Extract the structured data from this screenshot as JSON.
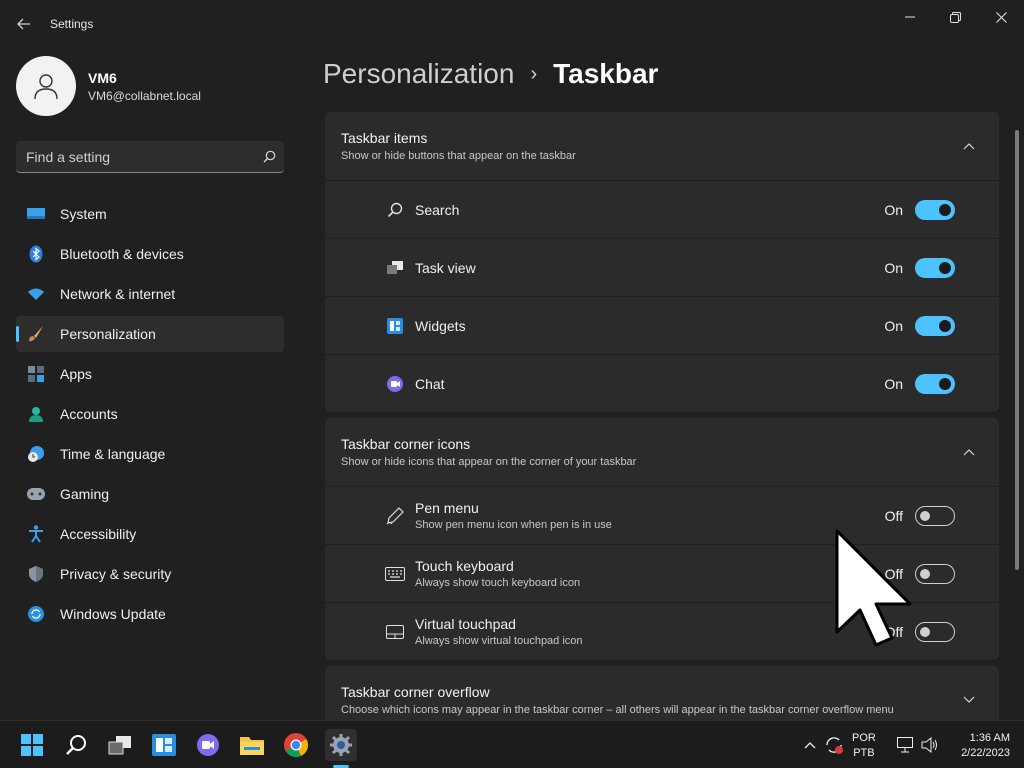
{
  "window": {
    "title": "Settings"
  },
  "profile": {
    "name": "VM6",
    "email": "VM6@collabnet.local"
  },
  "search": {
    "placeholder": "Find a setting"
  },
  "sidebar": {
    "items": [
      {
        "label": "System",
        "icon": "monitor-icon",
        "active": false
      },
      {
        "label": "Bluetooth & devices",
        "icon": "bluetooth-icon",
        "active": false
      },
      {
        "label": "Network & internet",
        "icon": "wifi-icon",
        "active": false
      },
      {
        "label": "Personalization",
        "icon": "brush-icon",
        "active": true
      },
      {
        "label": "Apps",
        "icon": "apps-icon",
        "active": false
      },
      {
        "label": "Accounts",
        "icon": "person-icon",
        "active": false
      },
      {
        "label": "Time & language",
        "icon": "globe-clock-icon",
        "active": false
      },
      {
        "label": "Gaming",
        "icon": "gamepad-icon",
        "active": false
      },
      {
        "label": "Accessibility",
        "icon": "accessibility-icon",
        "active": false
      },
      {
        "label": "Privacy & security",
        "icon": "shield-icon",
        "active": false
      },
      {
        "label": "Windows Update",
        "icon": "update-icon",
        "active": false
      }
    ]
  },
  "breadcrumb": {
    "parent": "Personalization",
    "separator": "›",
    "current": "Taskbar"
  },
  "sections": {
    "items": {
      "title": "Taskbar items",
      "desc": "Show or hide buttons that appear on the taskbar",
      "rows": [
        {
          "label": "Search",
          "state": "On",
          "icon": "search-icon"
        },
        {
          "label": "Task view",
          "state": "On",
          "icon": "task-view-icon"
        },
        {
          "label": "Widgets",
          "state": "On",
          "icon": "widgets-icon"
        },
        {
          "label": "Chat",
          "state": "On",
          "icon": "chat-icon"
        }
      ]
    },
    "corner": {
      "title": "Taskbar corner icons",
      "desc": "Show or hide icons that appear on the corner of your taskbar",
      "rows": [
        {
          "label": "Pen menu",
          "sub": "Show pen menu icon when pen is in use",
          "state": "Off",
          "icon": "pen-icon"
        },
        {
          "label": "Touch keyboard",
          "sub": "Always show touch keyboard icon",
          "state": "Off",
          "icon": "keyboard-icon"
        },
        {
          "label": "Virtual touchpad",
          "sub": "Always show virtual touchpad icon",
          "state": "Off",
          "icon": "touchpad-icon"
        }
      ]
    },
    "overflow": {
      "title": "Taskbar corner overflow",
      "desc": "Choose which icons may appear in the taskbar corner – all others will appear in the taskbar corner overflow menu"
    }
  },
  "taskbar": {
    "lang_top": "POR",
    "lang_bottom": "PTB",
    "time": "1:36 AM",
    "date": "2/22/2023"
  },
  "colors": {
    "accent": "#4cc2ff",
    "background": "#202020",
    "card": "#2b2b2b"
  }
}
